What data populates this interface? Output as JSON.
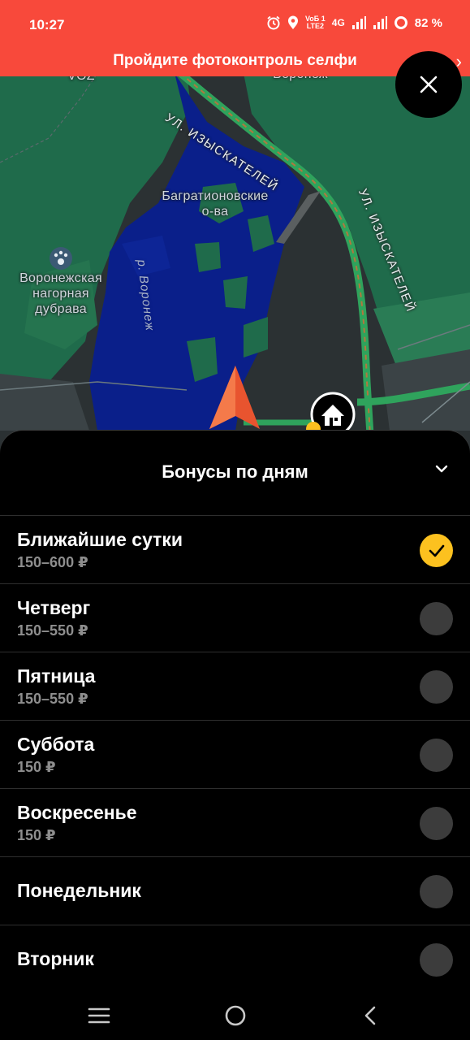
{
  "status_bar": {
    "time": "10:27",
    "volte_top": "VoБ 1",
    "volte_bottom": "LTE2",
    "network": "4G",
    "battery": "82 %"
  },
  "banner": {
    "text": "Пройдите фотоконтроль селфи",
    "chevron": "›"
  },
  "map": {
    "labels": {
      "street_1": "УЛ. ИЗЫСКАТЕЛЕЙ",
      "street_2": "УЛ. ИЗЫСКАТЕЛЕЙ",
      "islands": "Багратионовские\nо-ва",
      "river": "р. Воронеж",
      "forest": "Воронежская\nнагорная\nдубрава",
      "cut_top_left": "VOZ",
      "cut_top_center": "Воронеж"
    }
  },
  "sheet": {
    "title": "Бонусы по дням",
    "items": [
      {
        "title": "Ближайшие сутки",
        "subtitle": "150–600 ₽",
        "selected": true
      },
      {
        "title": "Четверг",
        "subtitle": "150–550 ₽",
        "selected": false
      },
      {
        "title": "Пятница",
        "subtitle": "150–550 ₽",
        "selected": false
      },
      {
        "title": "Суббота",
        "subtitle": "150 ₽",
        "selected": false
      },
      {
        "title": "Воскресенье",
        "subtitle": "150 ₽",
        "selected": false
      },
      {
        "title": "Понедельник",
        "subtitle": "",
        "selected": false
      },
      {
        "title": "Вторник",
        "subtitle": "",
        "selected": false
      }
    ]
  },
  "colors": {
    "banner_red": "#f8493b",
    "selected_yellow": "#fcc11f",
    "water_blue": "#0a1f8a",
    "forest_green": "#1c6b4a",
    "road_green": "#2fa35c"
  },
  "icons": [
    "alarm-icon",
    "location-icon",
    "signal-icon",
    "battery-ring-icon",
    "close-icon",
    "chevron-down-icon",
    "check-icon",
    "home-marker-icon",
    "navigation-arrow-icon",
    "menu-icon",
    "home-circle-icon",
    "back-icon"
  ]
}
